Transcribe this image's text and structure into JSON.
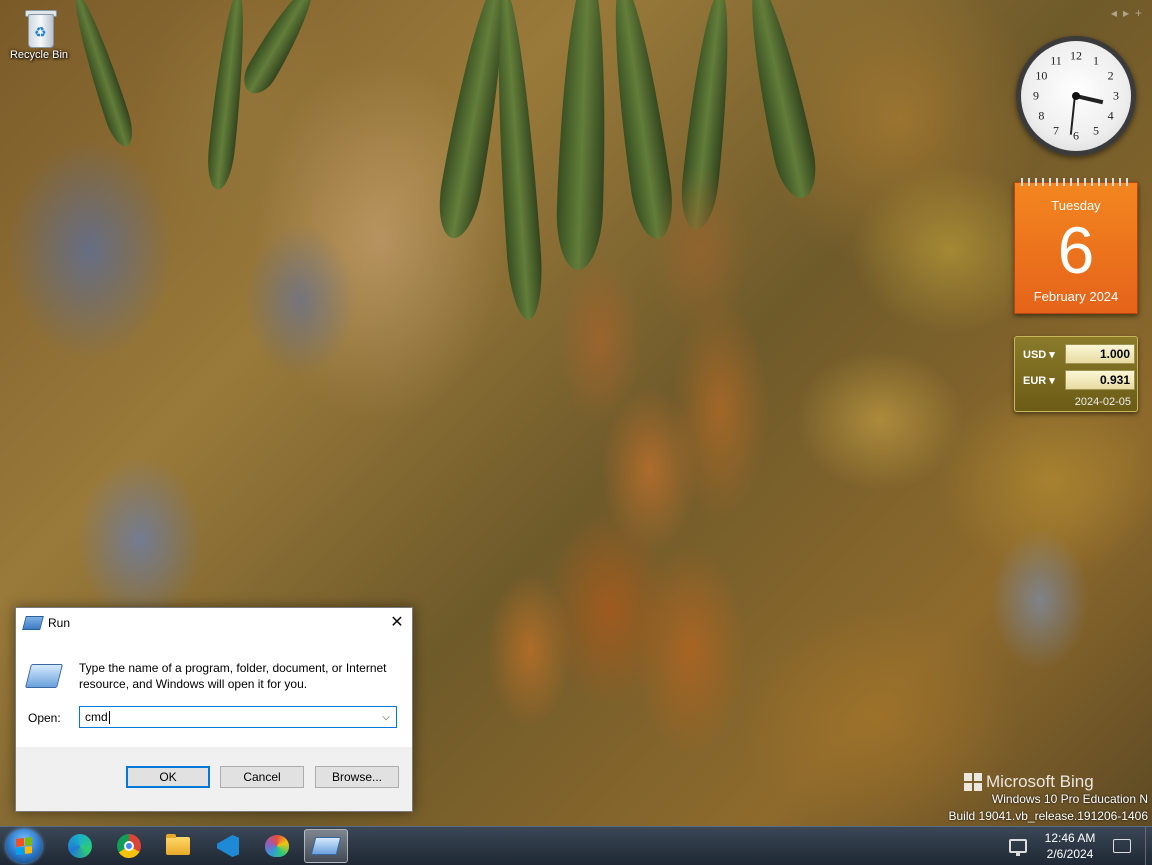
{
  "desktop": {
    "icons": [
      {
        "label": "Recycle Bin",
        "icon": "recycle-bin-icon"
      }
    ]
  },
  "gadgets": {
    "toolbar": [
      "◂",
      "▸",
      "+"
    ],
    "clock": {
      "numbers": [
        "12",
        "1",
        "2",
        "3",
        "4",
        "5",
        "6",
        "7",
        "8",
        "9",
        "10",
        "11"
      ],
      "hour_hand_deg": 103,
      "minute_hand_deg": 186
    },
    "calendar": {
      "day_of_week": "Tuesday",
      "day": "6",
      "month_year": "February 2024"
    },
    "currency": {
      "rows": [
        {
          "code": "USD ▾",
          "value": "1.000"
        },
        {
          "code": "EUR ▾",
          "value": "0.931"
        }
      ],
      "date": "2024-02-05"
    }
  },
  "watermark": {
    "bing": "Microsoft Bing",
    "os_line1": "Windows 10 Pro Education N",
    "os_line2": "Build 19041.vb_release.191206-1406"
  },
  "run_dialog": {
    "title": "Run",
    "close": "✕",
    "description": "Type the name of a program, folder, document, or Internet resource, and Windows will open it for you.",
    "open_label": "Open:",
    "open_value": "cmd",
    "dropdown": "⌵",
    "buttons": {
      "ok": "OK",
      "cancel": "Cancel",
      "browse": "Browse..."
    }
  },
  "taskbar": {
    "apps": [
      {
        "name": "edge",
        "icon": "edge-icon"
      },
      {
        "name": "chrome",
        "icon": "chrome-icon"
      },
      {
        "name": "file-explorer",
        "icon": "folder-icon"
      },
      {
        "name": "vscode",
        "icon": "vscode-icon"
      },
      {
        "name": "paint",
        "icon": "paint-icon"
      },
      {
        "name": "run",
        "icon": "run-icon",
        "active": true
      }
    ],
    "tray": {
      "time": "12:46 AM",
      "date": "2/6/2024"
    }
  },
  "colors": {
    "calendar": "#e86a1c",
    "run_accent": "#0078d7",
    "taskbar": "#2a3543"
  }
}
